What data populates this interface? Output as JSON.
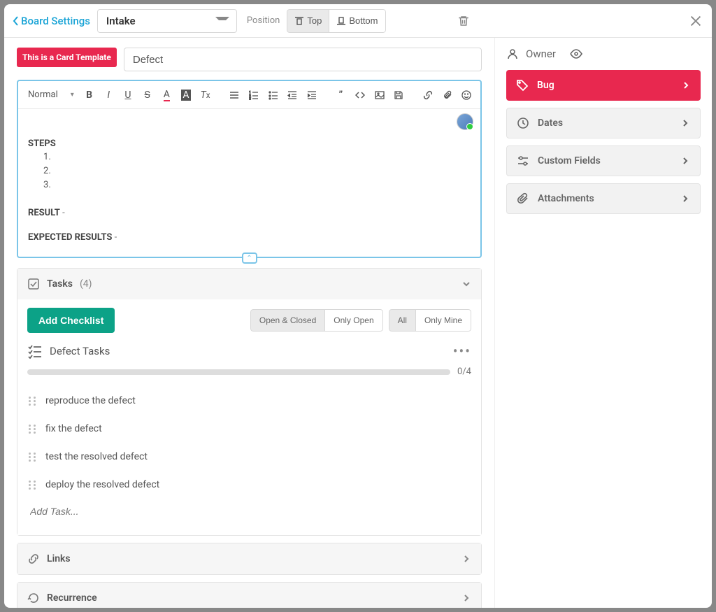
{
  "header": {
    "back_label": "Board Settings",
    "lane_select": "Intake",
    "position_label": "Position",
    "top_label": "Top",
    "bottom_label": "Bottom"
  },
  "card": {
    "template_badge": "This is a Card Template",
    "title": "Defect",
    "editor": {
      "format_select": "Normal",
      "steps_heading": "STEPS",
      "steps": [
        "",
        "",
        ""
      ],
      "result_heading": "RESULT",
      "result_suffix": " -",
      "expected_heading": "EXPECTED RESULTS",
      "expected_suffix": " -"
    }
  },
  "tasks": {
    "section_title": "Tasks",
    "count": "(4)",
    "add_checklist_label": "Add Checklist",
    "filters_status": [
      "Open & Closed",
      "Only Open"
    ],
    "filters_scope": [
      "All",
      "Only Mine"
    ],
    "checklist_title": "Defect Tasks",
    "progress": "0/4",
    "items": [
      "reproduce the defect",
      "fix the defect",
      "test the resolved defect",
      "deploy the resolved defect"
    ],
    "add_task_placeholder": "Add Task..."
  },
  "links": {
    "title": "Links"
  },
  "recurrence": {
    "title": "Recurrence"
  },
  "sidebar": {
    "owner_label": "Owner",
    "panels": {
      "tag": "Bug",
      "dates": "Dates",
      "custom_fields": "Custom Fields",
      "attachments": "Attachments"
    }
  }
}
